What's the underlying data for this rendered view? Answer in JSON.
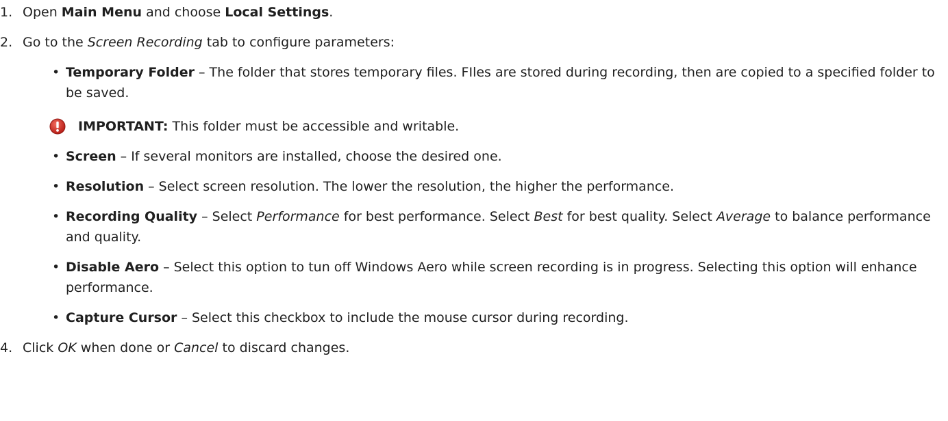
{
  "step1": {
    "num": "1.",
    "t1": "Open ",
    "b1": "Main Menu",
    "t2": " and choose ",
    "b2": "Local Settings",
    "t3": "."
  },
  "step2": {
    "num": "2.",
    "t1": "Go to the ",
    "i1": "Screen Recording",
    "t2": " tab to configure parameters:"
  },
  "bullets": [
    {
      "term": "Temporary Folder",
      "desc": " – The folder that stores temporary files. FIles are stored during recording, then are copied to a specified folder to be saved."
    },
    {
      "term": "Screen",
      "desc": " – If several monitors are installed, choose the desired one."
    },
    {
      "term": "Resolution",
      "desc": " – Select screen resolution. The lower the resolution, the higher the performance."
    },
    {
      "term": "Recording Quality",
      "d1": " – Select ",
      "i1": "Performance",
      "d2": " for best performance. Select ",
      "i2": "Best",
      "d3": " for best quality. Select ",
      "i3": "Average",
      "d4": " to balance performance and quality."
    },
    {
      "term": "Disable Aero",
      "desc": " – Select this option to tun off Windows Aero while screen recording is in progress. Selecting this option will enhance performance."
    },
    {
      "term": "Capture Cursor",
      "desc": " – Select this checkbox to include the mouse cursor during recording."
    }
  ],
  "important": {
    "icon": "alert-icon",
    "label": "IMPORTANT:",
    "text": " This folder must be accessible and writable."
  },
  "step4": {
    "num": "4.",
    "t1": "Click ",
    "i1": "OK",
    "t2": " when done or ",
    "i2": "Cancel",
    "t3": " to discard changes."
  },
  "colors": {
    "text": "#1f1f1f",
    "alert_red": "#d9302a"
  }
}
